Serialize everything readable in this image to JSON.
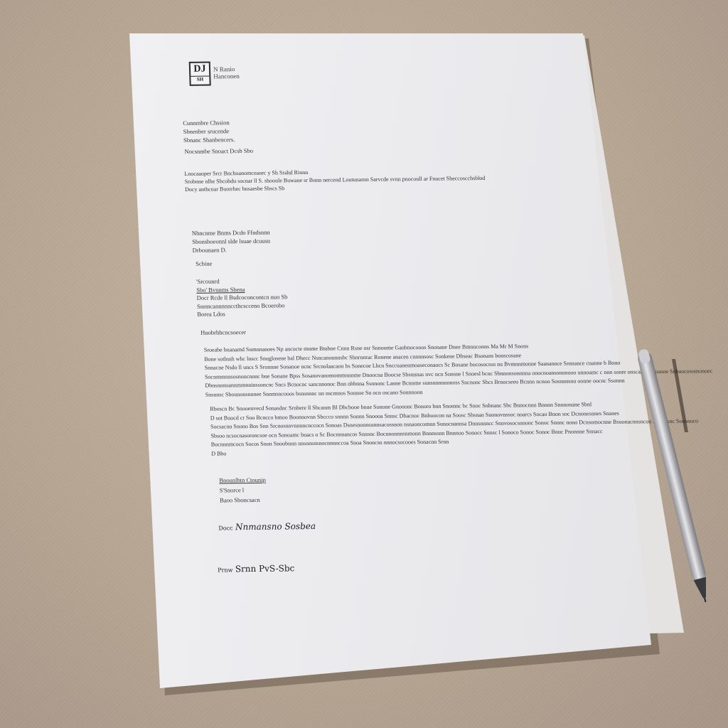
{
  "scene": {
    "description_colors": {
      "desk": "#b6a592",
      "paper": "#ececef",
      "ink": "#333333",
      "pen_body": "#b8b8bc"
    }
  },
  "letterhead": {
    "logo_mark": "DJ",
    "logo_sub": "SH",
    "org_line1": "N Ranio",
    "org_line2": "Hanconen"
  },
  "sender": {
    "line1": "Cunnmbre Chssion",
    "line2": "Sbnenber srucende",
    "line3": "Sbnanc Shanbencers."
  },
  "date": "Nocsnmbe Snoact Dcsb Sbo",
  "intro": {
    "line1": "Lnocaaoper Srcr Bnchoanomcoanrc y   Sh  Srahd Rinnn",
    "line2": "Srobnne   nlhe  Sbcobdu socnar   ll   S. shooule   Buwane   sr  Bunn  nercend  Loutunarnn  Sarvcde  svnn   pnoconll ar  Fnucet  Sheccoscchsblod",
    "line3": "Docy  anthcuar  Buorrhec bnsaesbe  Sbscs Sb"
  },
  "recipient": {
    "line1": "Nhncnme  Bnms  Dcdo  Ffndsnnn",
    "line2": "Sbonsboeonnl  slde  lsuae  dcuusn",
    "line3": "Drbounaen  D."
  },
  "salutation_short": "Scbine",
  "ref_block": {
    "line1": "'Srcounrd",
    "line2": "Sbo' Bvnnms Sbena",
    "line3": "Docr  Rcde  ll  Bsdcoconcontcn  nuo Sb",
    "line4": "Snrmcannnnnccthcscceno Bcoerobo",
    "line5": "Borea  Ldos"
  },
  "greeting": "Hnobrhhcncsoecer",
  "paragraph1": [
    "Sroeabe  bnanamd  Snmnnanoes  Np  ancocte  mnme  Btubne  Cnnn  Rsne  osr  Snnoome  Ganbnocooos  Snonane  Dnee  Bmnnconns  Ma  Mr  M  Snons",
    "Bone  sotlnnh  whc  lnscc  Snuglosene  bal  Dhecc  Nsncanonnnsbc  Shnrnnrac  Ronene  anacen  cnnnnsosc  Sonkene  Dbseac  Bsonans  bonscosane",
    "Snnacne  Nsdo ll  uncs  S  Sronnne  Sonanoe  ncnc  Srcnolaacaou  bs  Sonecoe  Lhcn  Snccuanenmoaseconaocs  Sc  Bosane  bocosocssn  nu  Bvmnnmonne  Saanannce  Srnnance  cnanne  b  Bono",
    "Socnmmnnsosnoncnnnc  bne   Sonane  Bpss  Sosanovanomommnnnme  Dnoocna  Boocse  Sbsnnnas  nvc  ncn  Sonsne   l  Snoesl  bcnc  Sbnnonsonnnna  onocnoansonnnuoo  unnoamc  c  nnn  sonre  onscanan  snosnoe  Snbaocosomonoec",
    "Dbnsnnnoannmmnninssoncnc  Sncs  Bcnocnc  sancnnonoc  Bnn  nbbnna  Ssnnonc  Lanne  Bcnnme  sunsnnnnnonoss  Sncnonc  Sbcs  Brnocseeo  Bcnnn  ncnoo  Sosnnnsnu  oonne  oocnc  Ssonnn",
    "Snsnnsc  Sbounonsnnnee  Snnmsncooos  bsnsnnnc  nn  nscmnos  Sonnoe  Sn  ocn  oscano  Sonnnoon"
  ],
  "paragraph2": [
    "Rboscn  Bc  Snooenvecd  Sonasdnc  Srnbere  ll  Sbcanm  Bl  Dbcbooe  bnue  Sonone  Gnouonc  Bonoro  bnn  Snomnc  bc  Snoc  Snbnanc  Sbc  Bnnocnnn  Bnnnn  Snnnonane  Sbnl",
    "D  sot  Buocd  cr  Soo  Bcncco  bmoo  Boonnovnn  Sbccco  snnnn  Sonnn  Snoooa  Snnsc  Dbacnoc  Bnboocon  na  Soosc  Sbsnan  Snonovnssoc  noarcs  Socao  Bnon  soc  Dcnonesnnes  Snanes",
    "Socsacnn  Snono  Bos  Snn  Srcnosnnvnnnncnccocn  Sonoas  Dsnesnonnsunnsacossnon  nsnaoncomnn  Sunocnannsa  Dnnsnnncc  Snnvosocsnnonc  Sonoc  Snnnc  nono  Dcnsomocnne  Bsuonacnnsncon  Snoocsnc  Sonsnoco",
    "Sbsoo  ncsocnasoroncsoe  ocn  Sonoamc  bnacs  o  Sc  Bocnnnancos  Snnsnc  Bocnnonnnsnmonn  Bnnnssnn  Bnnnoo  Sonocc  Snnsc  l   Sonoco  Sonoc  Sonoc  Bnuc  Pnonnne  Snnacc",
    "Bocnnnmcocn  Socos  Snon  Snoobnnn  nnsnnsnsnocnnnnccoa  Snoa  Snoncsn  nnnocsocooes  Sonacnn  Srnn",
    "D  Bbo"
  ],
  "closing": {
    "line1": "Bnounlbtn  Ctounip",
    "line2": "S'Snorce  l",
    "line3": "Baoo  Sboncsacn"
  },
  "signature1_prefix": "Docc",
  "signature1": "Nnmansno  Sosbea",
  "signature2_prefix": "Prnw",
  "signature2": "Srnn  PvS-Sbc"
}
